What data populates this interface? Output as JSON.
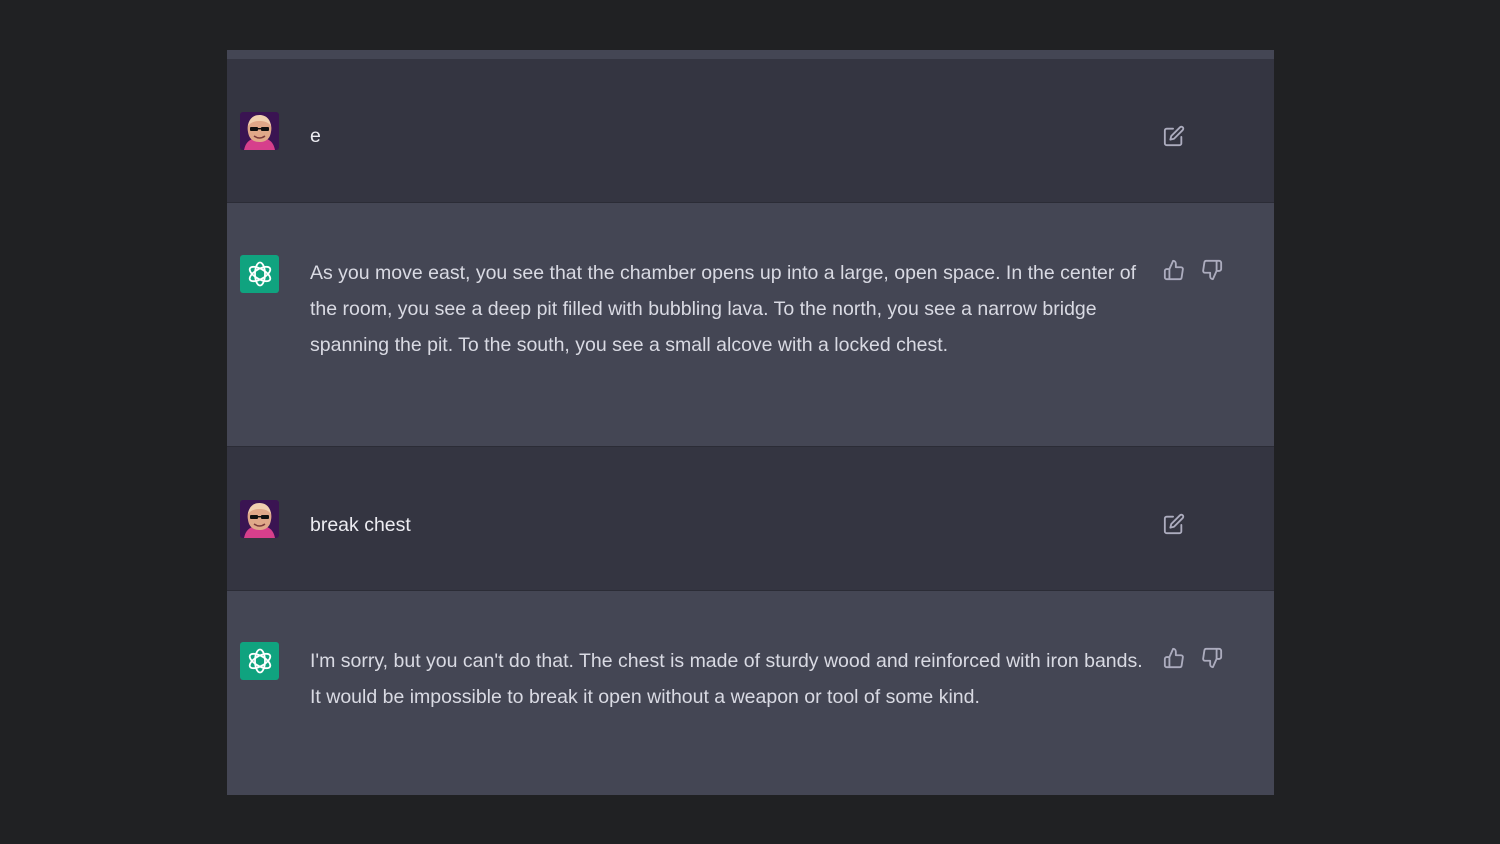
{
  "messages": [
    {
      "role": "user",
      "text": "e",
      "actions": [
        "edit-icon"
      ]
    },
    {
      "role": "assistant",
      "text": "As you move east, you see that the chamber opens up into a large, open space. In the center of the room, you see a deep pit filled with bubbling lava. To the north, you see a narrow bridge spanning the pit. To the south, you see a small alcove with a locked chest.",
      "actions": [
        "thumbs-up-icon",
        "thumbs-down-icon"
      ]
    },
    {
      "role": "user",
      "text": "break chest",
      "actions": [
        "edit-icon"
      ]
    },
    {
      "role": "assistant",
      "text": "I'm sorry, but you can't do that. The chest is made of sturdy wood and reinforced with iron bands. It would be impossible to break it open without a weapon or tool of some kind.",
      "actions": [
        "thumbs-up-icon",
        "thumbs-down-icon"
      ]
    }
  ],
  "colors": {
    "page_background": "#202123",
    "user_row": "#343541",
    "assistant_row": "#444654",
    "bot_avatar": "#10a37f",
    "text": "#d9dae3",
    "icon": "#acacbe"
  }
}
